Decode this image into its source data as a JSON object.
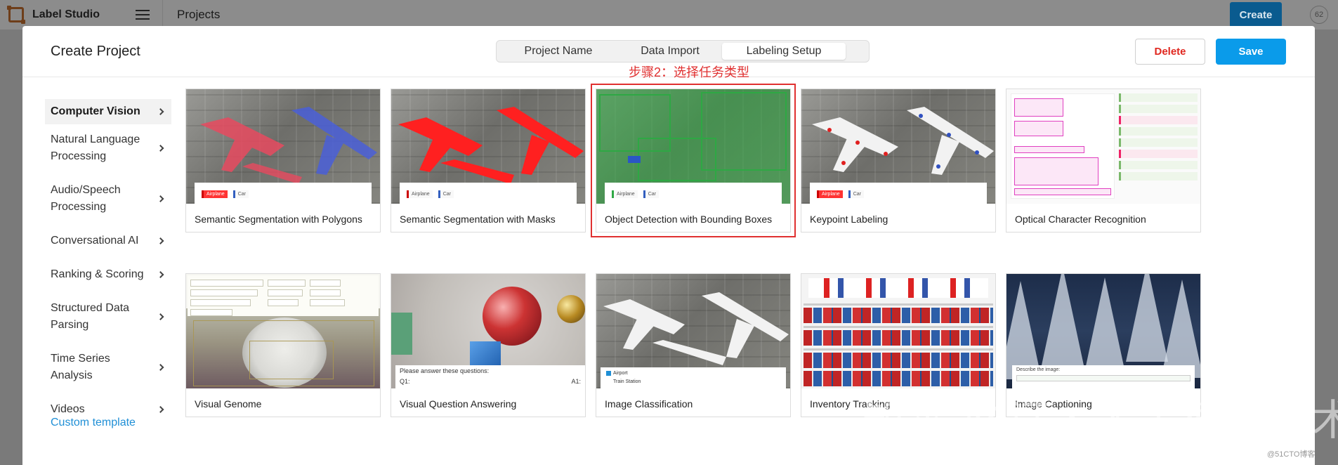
{
  "topbar": {
    "app_name": "Label Studio",
    "page": "Projects",
    "create_label": "Create",
    "avatar": "62"
  },
  "modal": {
    "title": "Create Project",
    "tabs": [
      "Project Name",
      "Data Import",
      "Labeling Setup"
    ],
    "active_tab": "Labeling Setup",
    "annotation": "步骤2：选择任务类型",
    "delete_label": "Delete",
    "save_label": "Save"
  },
  "sidebar": {
    "items": [
      {
        "label": "Computer Vision",
        "active": true
      },
      {
        "label": "Natural Language Processing"
      },
      {
        "label": "Audio/Speech Processing"
      },
      {
        "label": "Conversational AI"
      },
      {
        "label": "Ranking & Scoring"
      },
      {
        "label": "Structured Data Parsing"
      },
      {
        "label": "Time Series Analysis"
      },
      {
        "label": "Videos"
      }
    ],
    "custom_template": "Custom template"
  },
  "templates": [
    {
      "title": "Semantic Segmentation with Polygons"
    },
    {
      "title": "Semantic Segmentation with Masks"
    },
    {
      "title": "Object Detection with Bounding Boxes",
      "selected": true
    },
    {
      "title": "Keypoint Labeling"
    },
    {
      "title": "Optical Character Recognition"
    },
    {
      "title": "Visual Genome"
    },
    {
      "title": "Visual Question Answering"
    },
    {
      "title": "Image Classification"
    },
    {
      "title": "Inventory Tracking"
    },
    {
      "title": "Image Captioning"
    }
  ],
  "thumb_text": {
    "airplane": "Airplane",
    "car": "Car",
    "vqa_prompt": "Please answer these questions:",
    "vqa_q1": "Q1:",
    "vqa_a1": "A1:",
    "ic_option1": "Airport",
    "ic_option2": "Train Station",
    "caption_prompt": "Describe the image:"
  },
  "watermark": {
    "main": "知乎 @汀丶人工智能技术",
    "corner": "@51CTO博客"
  },
  "colors": {
    "primary": "#0a9bea",
    "delete": "#e0271f",
    "annotation": "#e03030",
    "link": "#1f8fd6"
  }
}
